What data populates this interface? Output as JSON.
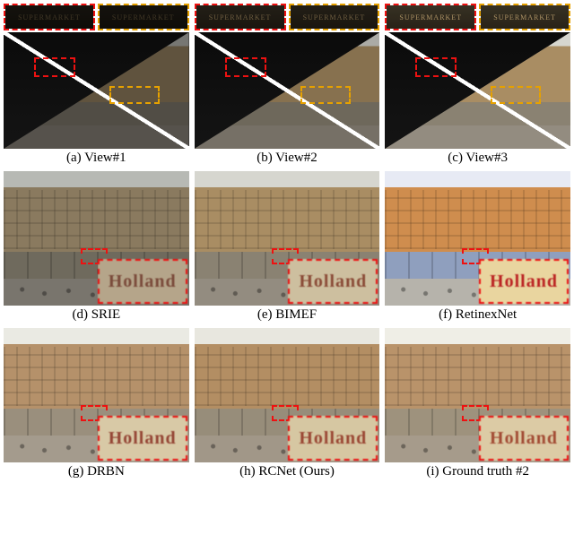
{
  "crop_sign_text": "SUPERMARKET",
  "inset_word": "Holland",
  "row1": [
    {
      "caption": "(a) View#1"
    },
    {
      "caption": "(b) View#2"
    },
    {
      "caption": "(c) View#3"
    }
  ],
  "row2": [
    {
      "caption": "(d) SRIE"
    },
    {
      "caption": "(e) BIMEF"
    },
    {
      "caption": "(f) RetinexNet"
    }
  ],
  "row3": [
    {
      "caption": "(g) DRBN"
    },
    {
      "caption": "(h) RCNet (Ours)"
    },
    {
      "caption": "(i) Ground truth #2"
    }
  ]
}
